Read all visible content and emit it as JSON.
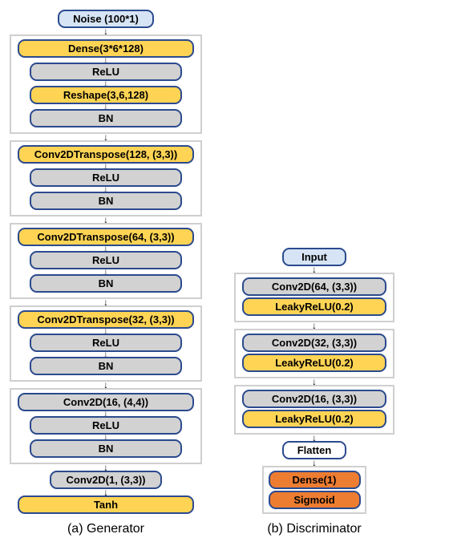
{
  "generator": {
    "caption": "(a) Generator",
    "input": "Noise (100*1)",
    "block1": {
      "dense": "Dense(3*6*128)",
      "relu": "ReLU",
      "reshape": "Reshape(3,6,128)",
      "bn": "BN"
    },
    "block2": {
      "conv": "Conv2DTranspose(128, (3,3))",
      "relu": "ReLU",
      "bn": "BN"
    },
    "block3": {
      "conv": "Conv2DTranspose(64, (3,3))",
      "relu": "ReLU",
      "bn": "BN"
    },
    "block4": {
      "conv": "Conv2DTranspose(32, (3,3))",
      "relu": "ReLU",
      "bn": "BN"
    },
    "block5": {
      "conv": "Conv2D(16, (4,4))",
      "relu": "ReLU",
      "bn": "BN"
    },
    "out_conv": "Conv2D(1, (3,3))",
    "out_act": "Tanh"
  },
  "discriminator": {
    "caption": "(b) Discriminator",
    "input": "Input",
    "block1": {
      "conv": "Conv2D(64, (3,3))",
      "act": "LeakyReLU(0.2)"
    },
    "block2": {
      "conv": "Conv2D(32, (3,3))",
      "act": "LeakyReLU(0.2)"
    },
    "block3": {
      "conv": "Conv2D(16, (3,3))",
      "act": "LeakyReLU(0.2)"
    },
    "flatten": "Flatten",
    "dense": "Dense(1)",
    "sigmoid": "Sigmoid"
  }
}
